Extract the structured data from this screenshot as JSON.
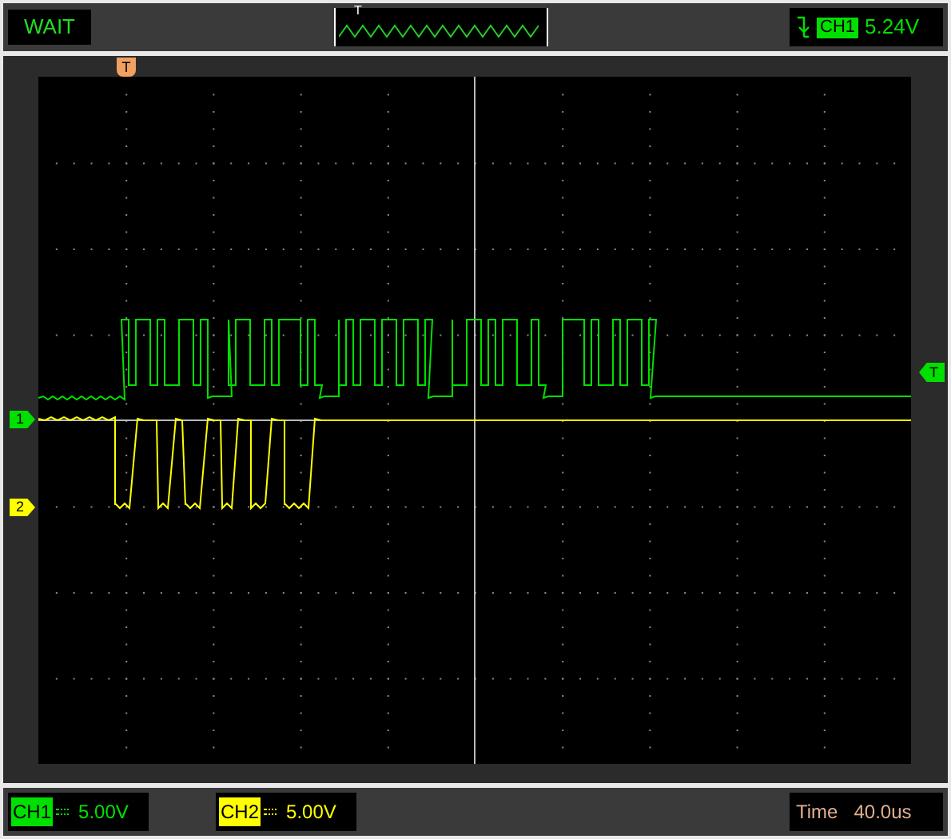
{
  "status": "WAIT",
  "preview": {
    "marker": "T"
  },
  "trigger": {
    "channel": "CH1",
    "level": "5.24V",
    "color": "#00e000"
  },
  "plot": {
    "trigger_marker": "T",
    "level_marker": "T",
    "channel_markers": [
      {
        "label": "1",
        "color": "#00e000"
      },
      {
        "label": "2",
        "color": "#ffff00"
      }
    ]
  },
  "channels": [
    {
      "name": "CH1",
      "volts": "5.00V",
      "color": "#00e000"
    },
    {
      "name": "CH2",
      "volts": "5.00V",
      "color": "#ffff00"
    }
  ],
  "time": {
    "label": "Time",
    "value": "40.0us"
  }
}
